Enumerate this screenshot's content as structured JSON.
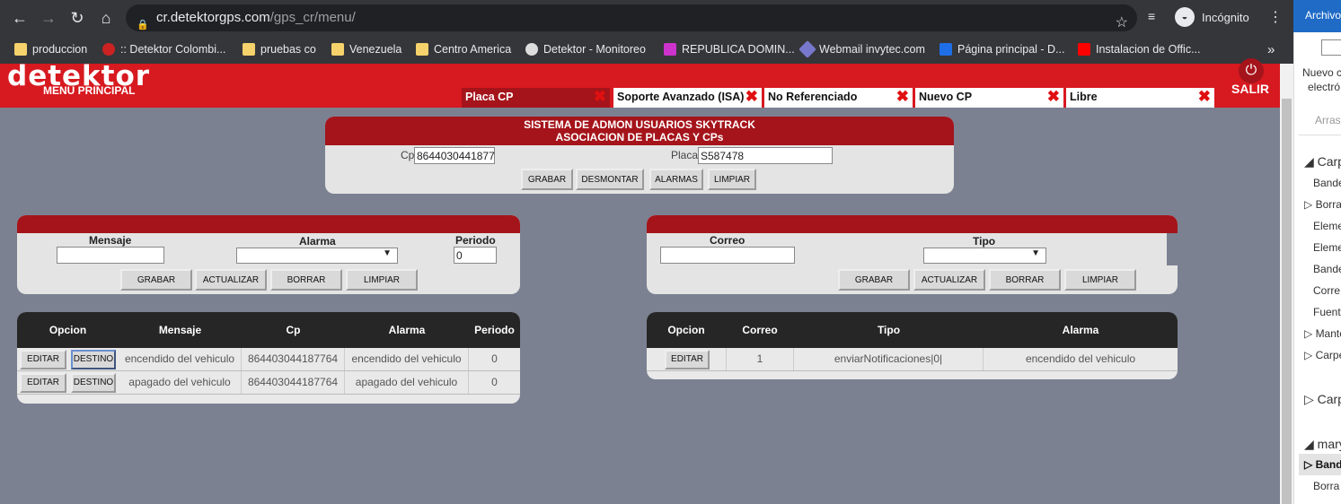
{
  "browser": {
    "url_host": "cr.detektorgps.com",
    "url_path": "/gps_cr/menu/",
    "profile": "Incógnito",
    "bookmarks": [
      "produccion",
      ":: Detektor Colombi...",
      "pruebas co",
      "Venezuela",
      "Centro America",
      "Detektor - Monitoreo",
      "REPUBLICA DOMIN...",
      "Webmail invytec.com",
      "Página principal - D...",
      "Instalacion de Offic..."
    ],
    "more": "»"
  },
  "header": {
    "logo": "detektor",
    "subtitle": "MENU PRINCIPAL",
    "logout": "SALIR",
    "tabs": [
      "Placa CP",
      "Soporte Avanzado (ISA)",
      "No Referenciado",
      "Nuevo CP",
      "Libre"
    ],
    "close_glyph": "✖"
  },
  "admin_panel": {
    "title1": "SISTEMA DE ADMON USUARIOS SKYTRACK",
    "title2": "ASOCIACION DE PLACAS Y CPs",
    "cp_label": "Cp",
    "cp_value": "8644030441877",
    "placa_label": "Placa",
    "placa_value": "S587478",
    "buttons": [
      "GRABAR",
      "DESMONTAR",
      "ALARMAS",
      "LIMPIAR"
    ]
  },
  "msg_form": {
    "mensaje_label": "Mensaje",
    "alarma_label": "Alarma",
    "periodo_label": "Periodo",
    "periodo_value": "0",
    "buttons": [
      "GRABAR",
      "ACTUALIZAR",
      "BORRAR",
      "LIMPIAR"
    ]
  },
  "mail_form": {
    "correo_label": "Correo",
    "tipo_label": "Tipo",
    "buttons": [
      "GRABAR",
      "ACTUALIZAR",
      "BORRAR",
      "LIMPIAR"
    ]
  },
  "msg_table": {
    "headers": [
      "Opcion",
      "Mensaje",
      "Cp",
      "Alarma",
      "Periodo"
    ],
    "edit_label": "EDITAR",
    "dest_label": "DESTINO",
    "rows": [
      {
        "mensaje": "encendido del vehiculo",
        "cp": "864403044187764",
        "alarma": "encendido del vehiculo",
        "periodo": "0"
      },
      {
        "mensaje": "apagado del vehiculo",
        "cp": "864403044187764",
        "alarma": "apagado del vehiculo",
        "periodo": "0"
      }
    ]
  },
  "mail_table": {
    "headers": [
      "Opcion",
      "Correo",
      "Tipo",
      "Alarma"
    ],
    "edit_label": "EDITAR",
    "rows": [
      {
        "correo": "1",
        "tipo": "enviarNotificaciones|0|",
        "alarma": "encendido del vehiculo"
      }
    ]
  },
  "sidebar": {
    "title": "Archivo",
    "new_line1": "Nuevo c",
    "new_line2": "electró",
    "drag": "Arrast",
    "items": [
      "Carpe",
      "Bande",
      "Borra",
      "Eleme",
      "Eleme",
      "Bande",
      "Corre",
      "Fuent",
      "Mante",
      "Carpe",
      "Carp",
      "mary",
      "Bande",
      "Borra"
    ]
  }
}
